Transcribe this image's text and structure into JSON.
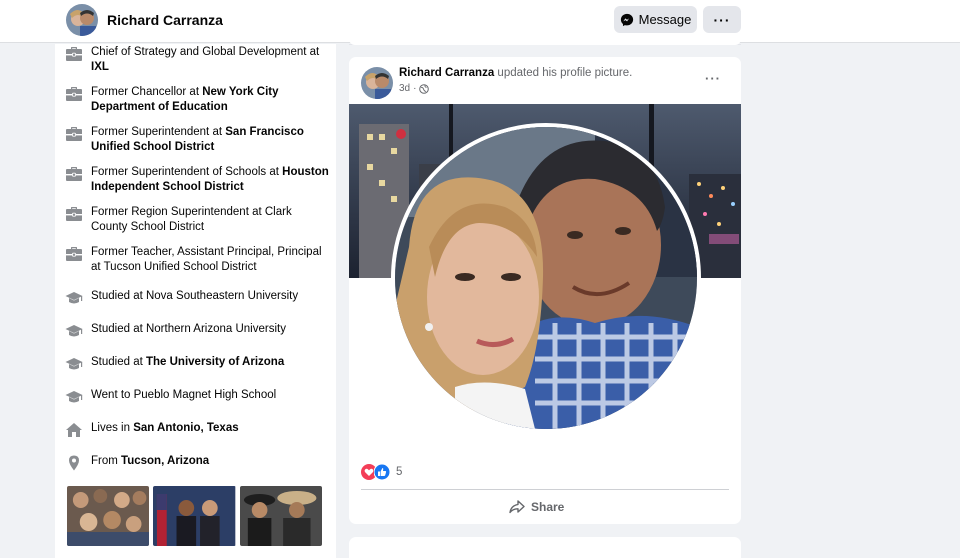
{
  "header": {
    "name": "Richard Carranza",
    "message_label": "Message",
    "more_label": "···"
  },
  "intro": {
    "items": [
      {
        "icon": "briefcase-icon",
        "prefix": "Chief of Strategy and Global Development at ",
        "bold": "IXL"
      },
      {
        "icon": "briefcase-icon",
        "prefix": "Former Chancellor at ",
        "bold": "New York City Department of Education"
      },
      {
        "icon": "briefcase-icon",
        "prefix": "Former Superintendent at ",
        "bold": "San Francisco Unified School District"
      },
      {
        "icon": "briefcase-icon",
        "prefix": "Former Superintendent of Schools at ",
        "bold": "Houston Independent School District"
      },
      {
        "icon": "briefcase-icon",
        "prefix": "Former Region Superintendent at Clark County School District",
        "bold": ""
      },
      {
        "icon": "briefcase-icon",
        "prefix": "Former Teacher, Assistant Principal, Principal at Tucson Unified School District",
        "bold": ""
      },
      {
        "icon": "graduation-cap-icon",
        "prefix": "Studied at Nova Southeastern University",
        "bold": ""
      },
      {
        "icon": "graduation-cap-icon",
        "prefix": "Studied at Northern Arizona University",
        "bold": ""
      },
      {
        "icon": "graduation-cap-icon",
        "prefix": "Studied at ",
        "bold": "The University of Arizona"
      },
      {
        "icon": "graduation-cap-icon",
        "prefix": "Went to Pueblo Magnet High School",
        "bold": ""
      },
      {
        "icon": "home-icon",
        "prefix": "Lives in ",
        "bold": "San Antonio, Texas"
      },
      {
        "icon": "location-pin-icon",
        "prefix": "From ",
        "bold": "Tucson, Arizona"
      }
    ]
  },
  "post": {
    "author": "Richard Carranza",
    "action": " updated his profile picture.",
    "time": "3d",
    "privacy_icon": "globe-icon",
    "menu_label": "···",
    "reaction_count": "5",
    "share_label": "Share"
  },
  "colors": {
    "background": "#f0f2f5",
    "card": "#ffffff",
    "secondary_text": "#65676b",
    "button_gray": "#e4e6eb",
    "like_blue": "#1877f2",
    "love_red": "#f33e58"
  }
}
